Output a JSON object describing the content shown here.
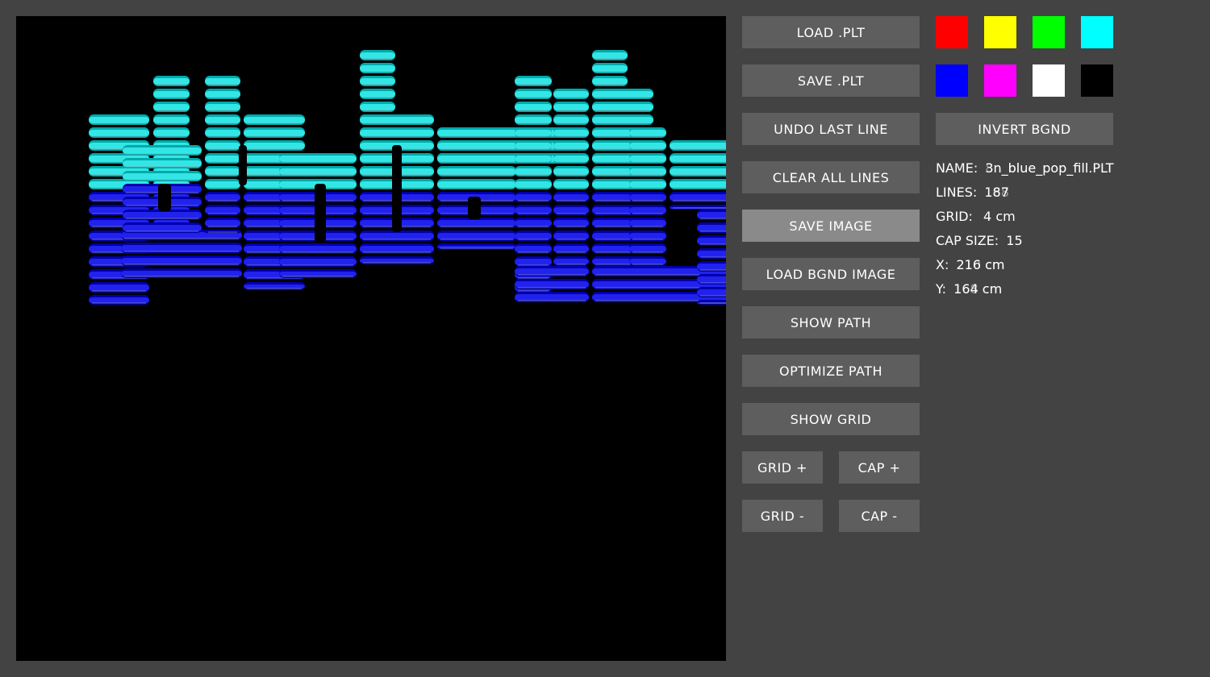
{
  "buttons": {
    "load_plt": "LOAD .PLT",
    "save_plt": "SAVE .PLT",
    "undo_last_line": "UNDO LAST LINE",
    "clear_all_lines": "CLEAR ALL LINES",
    "save_image": "SAVE IMAGE",
    "load_bgnd_image": "LOAD BGND IMAGE",
    "show_path": "SHOW PATH",
    "optimize_path": "OPTIMIZE PATH",
    "show_grid": "SHOW GRID",
    "grid_plus": "GRID +",
    "cap_plus": "CAP +",
    "grid_minus": "GRID -",
    "cap_minus": "CAP -",
    "invert_bgnd": "INVERT BGND"
  },
  "palette": [
    {
      "name": "red",
      "color": "#ff0000"
    },
    {
      "name": "yellow",
      "color": "#ffff00"
    },
    {
      "name": "green",
      "color": "#00ff00"
    },
    {
      "name": "cyan",
      "color": "#00ffff"
    },
    {
      "name": "blue",
      "color": "#0000ff"
    },
    {
      "name": "magenta",
      "color": "#ff00ff"
    },
    {
      "name": "white",
      "color": "#ffffff"
    },
    {
      "name": "black",
      "color": "#000000"
    }
  ],
  "info": {
    "name_label": "NAME:",
    "name_value": "3n_blue_pop_fill.PLT",
    "name_ghost": "8n_blue_pop_fill.PLT",
    "lines_label": "LINES:",
    "lines_value": "187",
    "lines_ghost": "168",
    "grid_label": "GRID:",
    "grid_value": "4 cm",
    "cap_label": "CAP SIZE:",
    "cap_value": "15",
    "x_label": "X:",
    "x_value": "216 cm",
    "x_ghost": "210 cm",
    "y_label": "Y:",
    "y_value": "164 cm",
    "y_ghost": "168 cm"
  },
  "drawing": {
    "cyan_fill": "#33e6e6",
    "cyan_dark": "#00aaaa",
    "blue_fill": "#2222ee",
    "blue_dark": "#0000aa",
    "split_level": 0.58
  }
}
